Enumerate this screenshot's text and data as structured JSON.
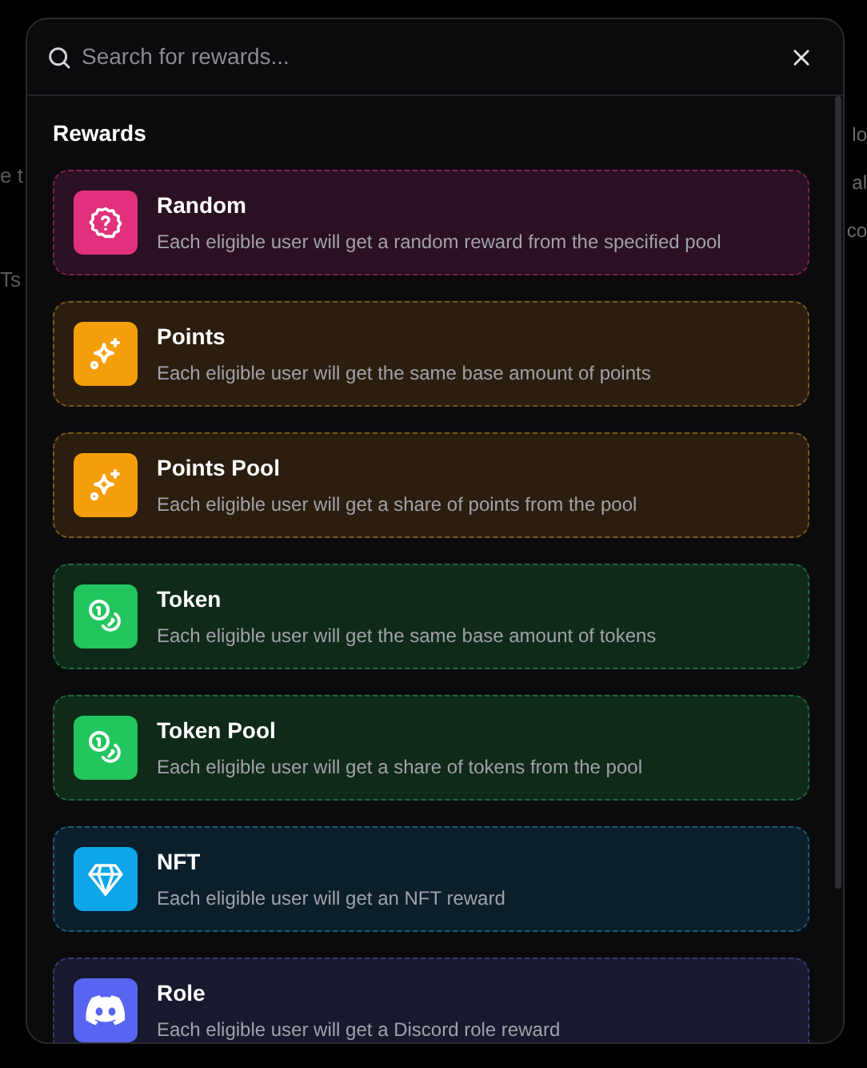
{
  "background_fragments": {
    "left": [
      "e t",
      "Ts"
    ],
    "right": [
      "lo",
      "al",
      "co"
    ]
  },
  "search": {
    "placeholder": "Search for rewards..."
  },
  "section_title": "Rewards",
  "rewards": [
    {
      "kind": "random",
      "title": "Random",
      "description": "Each eligible user will get a random reward from the specified pool"
    },
    {
      "kind": "points",
      "title": "Points",
      "description": "Each eligible user will get the same base amount of points"
    },
    {
      "kind": "points",
      "title": "Points Pool",
      "description": "Each eligible user will get a share of points from the pool"
    },
    {
      "kind": "token",
      "title": "Token",
      "description": "Each eligible user will get the same base amount of tokens"
    },
    {
      "kind": "token",
      "title": "Token Pool",
      "description": "Each eligible user will get a share of tokens from the pool"
    },
    {
      "kind": "nft",
      "title": "NFT",
      "description": "Each eligible user will get an NFT reward"
    },
    {
      "kind": "role",
      "title": "Role",
      "description": "Each eligible user will get a Discord role reward"
    }
  ]
}
